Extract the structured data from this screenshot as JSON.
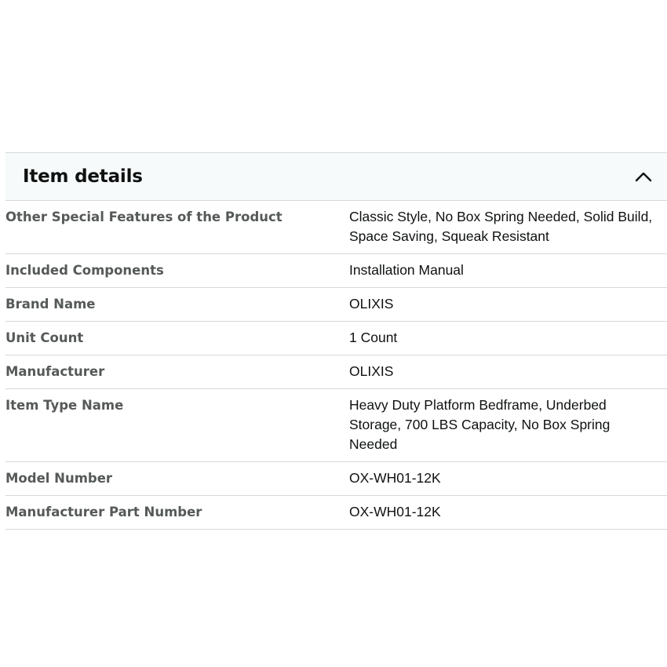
{
  "section": {
    "title": "Item details",
    "toggle_icon": "chevron-up-icon"
  },
  "rows": [
    {
      "label": "Other Special Features of the Product",
      "value": "Classic Style, No Box Spring Needed, Solid Build, Space Saving, Squeak Resistant"
    },
    {
      "label": "Included Components",
      "value": "Installation Manual"
    },
    {
      "label": "Brand Name",
      "value": "OLIXIS"
    },
    {
      "label": "Unit Count",
      "value": "1 Count"
    },
    {
      "label": "Manufacturer",
      "value": "OLIXIS"
    },
    {
      "label": "Item Type Name",
      "value": "Heavy Duty Platform Bedframe, Underbed Storage, 700 LBS Capacity, No Box Spring Needed"
    },
    {
      "label": "Model Number",
      "value": "OX-WH01-12K"
    },
    {
      "label": "Manufacturer Part Number",
      "value": "OX-WH01-12K"
    }
  ]
}
